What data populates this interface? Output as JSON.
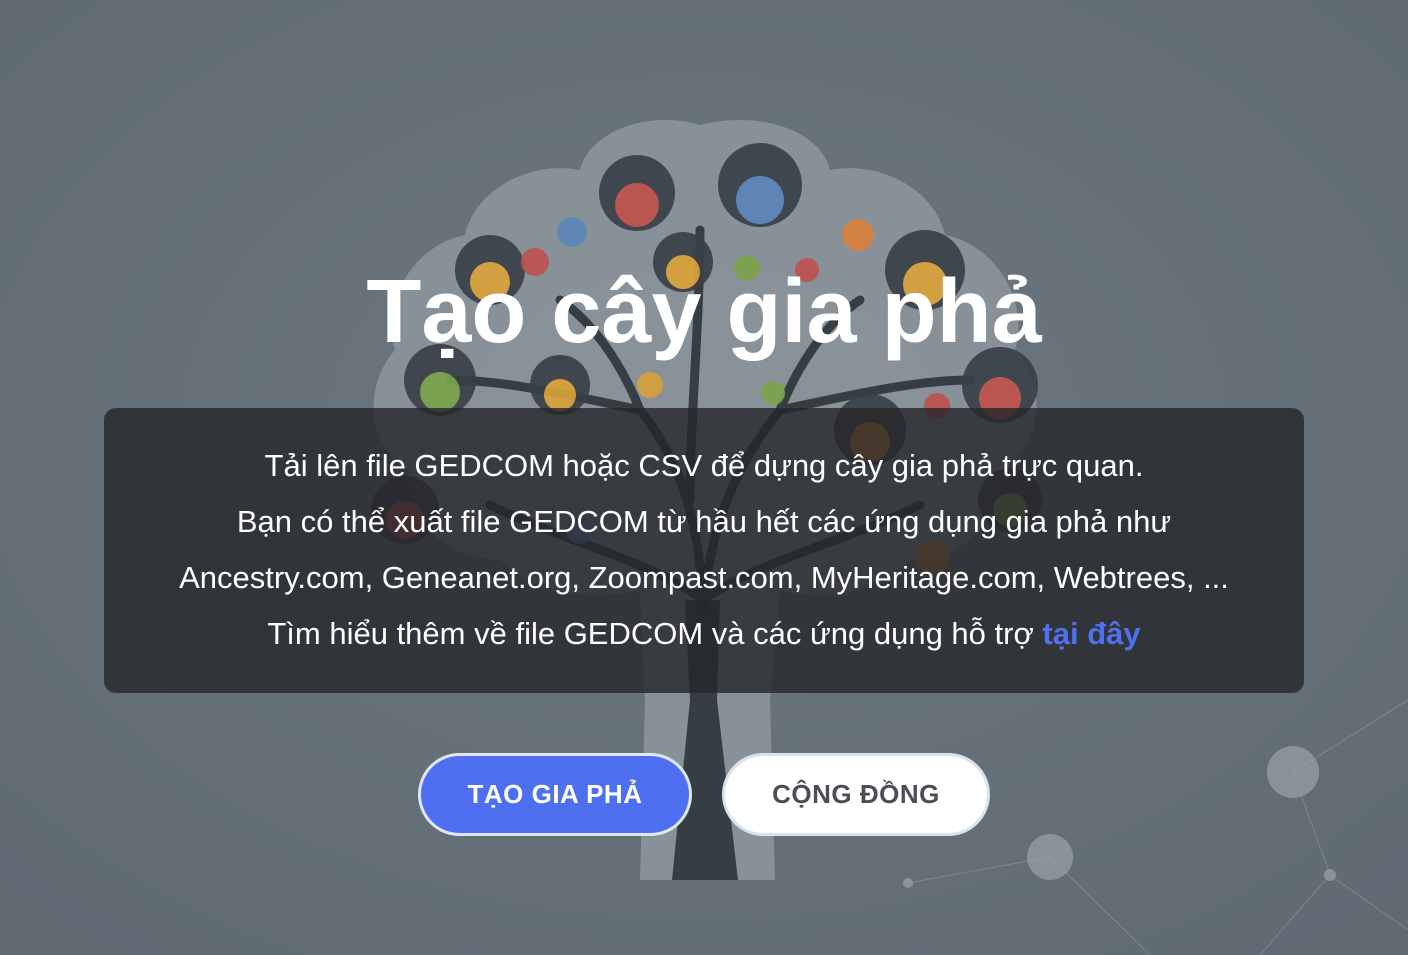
{
  "hero": {
    "title": "Tạo cây gia phả",
    "background_image": "family-tree-illustration"
  },
  "info": {
    "line1": "Tải lên file GEDCOM hoặc CSV để dựng cây gia phả trực quan.",
    "line2": "Bạn có thể xuất file GEDCOM từ hầu hết các ứng dụng gia phả như",
    "line3": "Ancestry.com, Geneanet.org, Zoompast.com, MyHeritage.com, Webtrees, ...",
    "line4_prefix": "Tìm hiểu thêm về file GEDCOM và các ứng dụng hỗ trợ ",
    "line4_link": "tại đây"
  },
  "actions": {
    "create_label": "TẠO GIA PHẢ",
    "community_label": "CỘNG ĐỒNG"
  },
  "colors": {
    "background": "#66717a",
    "accent": "#4e6ff0",
    "link": "#4f71f0",
    "panel": "#242629"
  }
}
